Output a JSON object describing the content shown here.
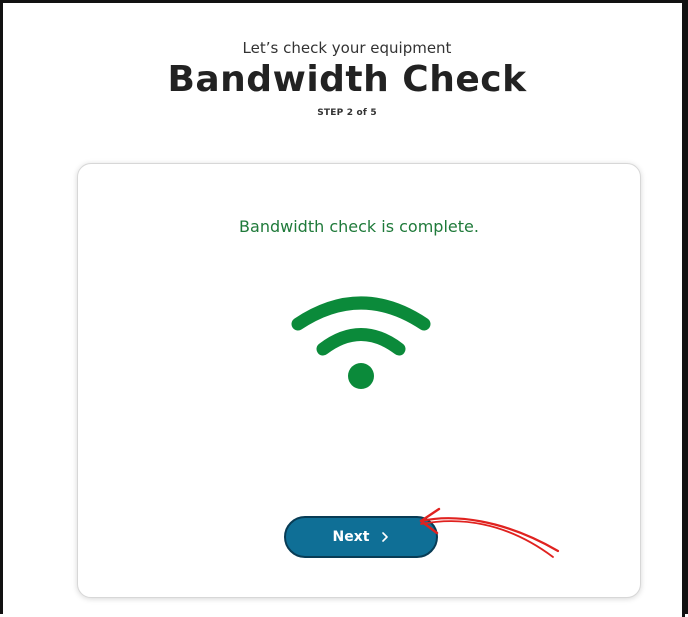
{
  "header": {
    "subtitle": "Let’s check your equipment",
    "title": "Bandwidth Check",
    "step": "STEP 2 of 5"
  },
  "card": {
    "status_text": "Bandwidth check is complete.",
    "icon": "wifi-icon",
    "next_button_label": "Next"
  },
  "colors": {
    "status_green": "#1f7a3a",
    "wifi_green": "#0b8a3a",
    "button_blue": "#0f6f96",
    "annotation_red": "#e0221f"
  }
}
